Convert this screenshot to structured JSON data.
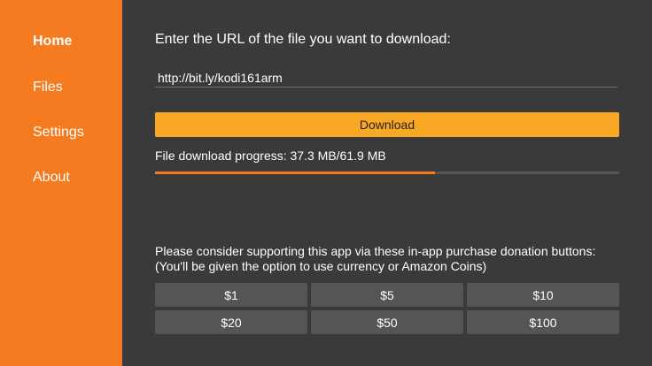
{
  "sidebar": {
    "items": [
      {
        "label": "Home",
        "active": true
      },
      {
        "label": "Files",
        "active": false
      },
      {
        "label": "Settings",
        "active": false
      },
      {
        "label": "About",
        "active": false
      }
    ]
  },
  "main": {
    "prompt": "Enter the URL of the file you want to download:",
    "url_input": {
      "value": "http://bit.ly/kodi161arm",
      "placeholder": ""
    },
    "download_label": "Download",
    "progress": {
      "text": "File download progress: 37.3 MB/61.9 MB",
      "downloaded_mb": 37.3,
      "total_mb": 61.9,
      "fraction": 0.6026
    },
    "donation": {
      "line1": "Please consider supporting this app via these in-app purchase donation buttons:",
      "line2": "(You'll be given the option to use currency or Amazon Coins)",
      "buttons": [
        "$1",
        "$5",
        "$10",
        "$20",
        "$50",
        "$100"
      ]
    }
  },
  "colors": {
    "sidebar_bg": "#f47b20",
    "main_bg": "#3a3a3a",
    "download_button_bg": "#f9a825",
    "progress_fill": "#f47b20",
    "donate_button_bg": "#555555"
  }
}
